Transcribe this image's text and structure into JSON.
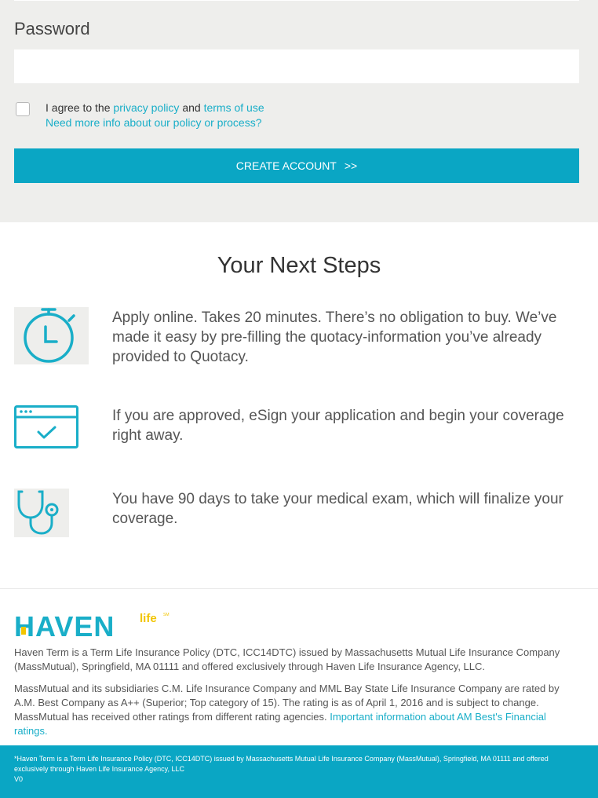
{
  "form": {
    "password_label": "Password",
    "password_value": "",
    "agree_prefix": "I agree to the ",
    "privacy_link": "privacy policy",
    "agree_and": " and ",
    "terms_link": "terms of use",
    "more_info_link": "Need more info about our policy or process?",
    "create_button": "CREATE ACCOUNT",
    "create_button_arrows": ">>"
  },
  "next_steps": {
    "title": "Your Next Steps",
    "steps": [
      {
        "icon": "stopwatch-icon",
        "text": "Apply online. Takes 20 minutes. There’s no obligation to buy. We’ve made it easy by pre-filling the quotacy-information you’ve already provided to Quotacy."
      },
      {
        "icon": "browser-check-icon",
        "text": "If you are approved, eSign your application and begin your coverage right away."
      },
      {
        "icon": "stethoscope-icon",
        "text": "You have 90 days to take your medical exam, which will finalize your coverage."
      }
    ]
  },
  "footer": {
    "logo_text": "HAVEN",
    "logo_life": "life",
    "logo_sm": "SM",
    "para1": "Haven Term is a Term Life Insurance Policy (DTC, ICC14DTC) issued by Massachusetts Mutual Life Insurance Company (MassMutual), Springfield, MA 01111 and offered exclusively through Haven Life Insurance Agency, LLC.",
    "para2": "MassMutual and its subsidiaries C.M. Life Insurance Company and MML Bay State Life Insurance Company are rated by A.M. Best Company as A++ (Superior; Top category of 15). The rating is as of April 1, 2016 and is subject to change. MassMutual has received other ratings from different rating agencies. ",
    "para2_link": "Important information about AM Best's Financial ratings.",
    "bar_text": "*Haven Term is a Term Life Insurance Policy (DTC, ICC14DTC) issued by Massachusetts Mutual Life Insurance Company (MassMutual), Springfield, MA 01111 and offered exclusively through Haven Life Insurance Agency, LLC",
    "version": "V0"
  },
  "colors": {
    "accent": "#0aa6c4",
    "logo_yellow": "#f2c500",
    "form_bg": "#eeeeec"
  }
}
